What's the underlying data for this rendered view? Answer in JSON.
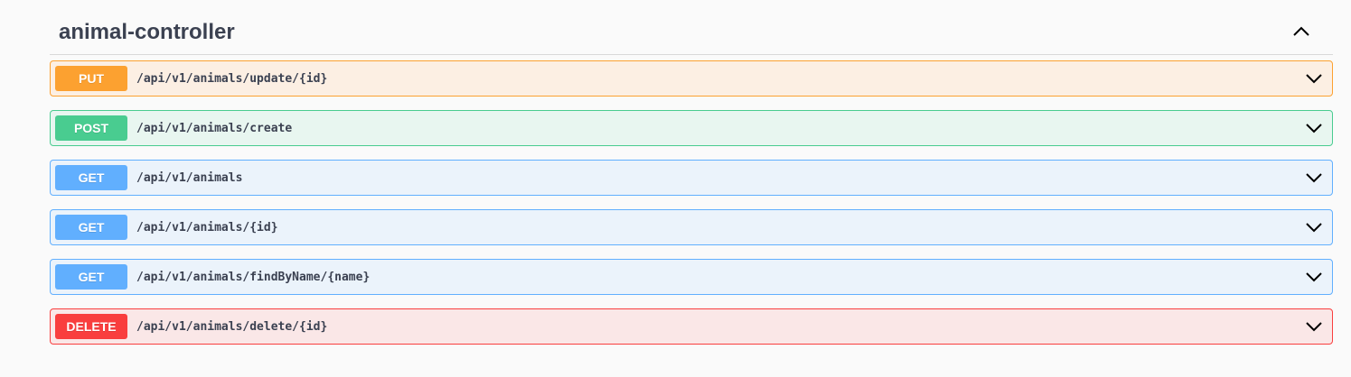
{
  "tag": {
    "title": "animal-controller",
    "collapse_icon": "chevron-up-icon"
  },
  "operations": [
    {
      "method": "PUT",
      "path": "/api/v1/animals/update/{id}",
      "color": "#fca130",
      "bg": "#fcefe3",
      "border": "#fca130"
    },
    {
      "method": "POST",
      "path": "/api/v1/animals/create",
      "color": "#49cc90",
      "bg": "#e8f6f0",
      "border": "#49cc90"
    },
    {
      "method": "GET",
      "path": "/api/v1/animals",
      "color": "#61affe",
      "bg": "#ebf3fb",
      "border": "#61affe"
    },
    {
      "method": "GET",
      "path": "/api/v1/animals/{id}",
      "color": "#61affe",
      "bg": "#ebf3fb",
      "border": "#61affe"
    },
    {
      "method": "GET",
      "path": "/api/v1/animals/findByName/{name}",
      "color": "#61affe",
      "bg": "#ebf3fb",
      "border": "#61affe"
    },
    {
      "method": "DELETE",
      "path": "/api/v1/animals/delete/{id}",
      "color": "#f93e3e",
      "bg": "#fae7e7",
      "border": "#f93e3e"
    }
  ],
  "expand_icon": "chevron-down-icon"
}
